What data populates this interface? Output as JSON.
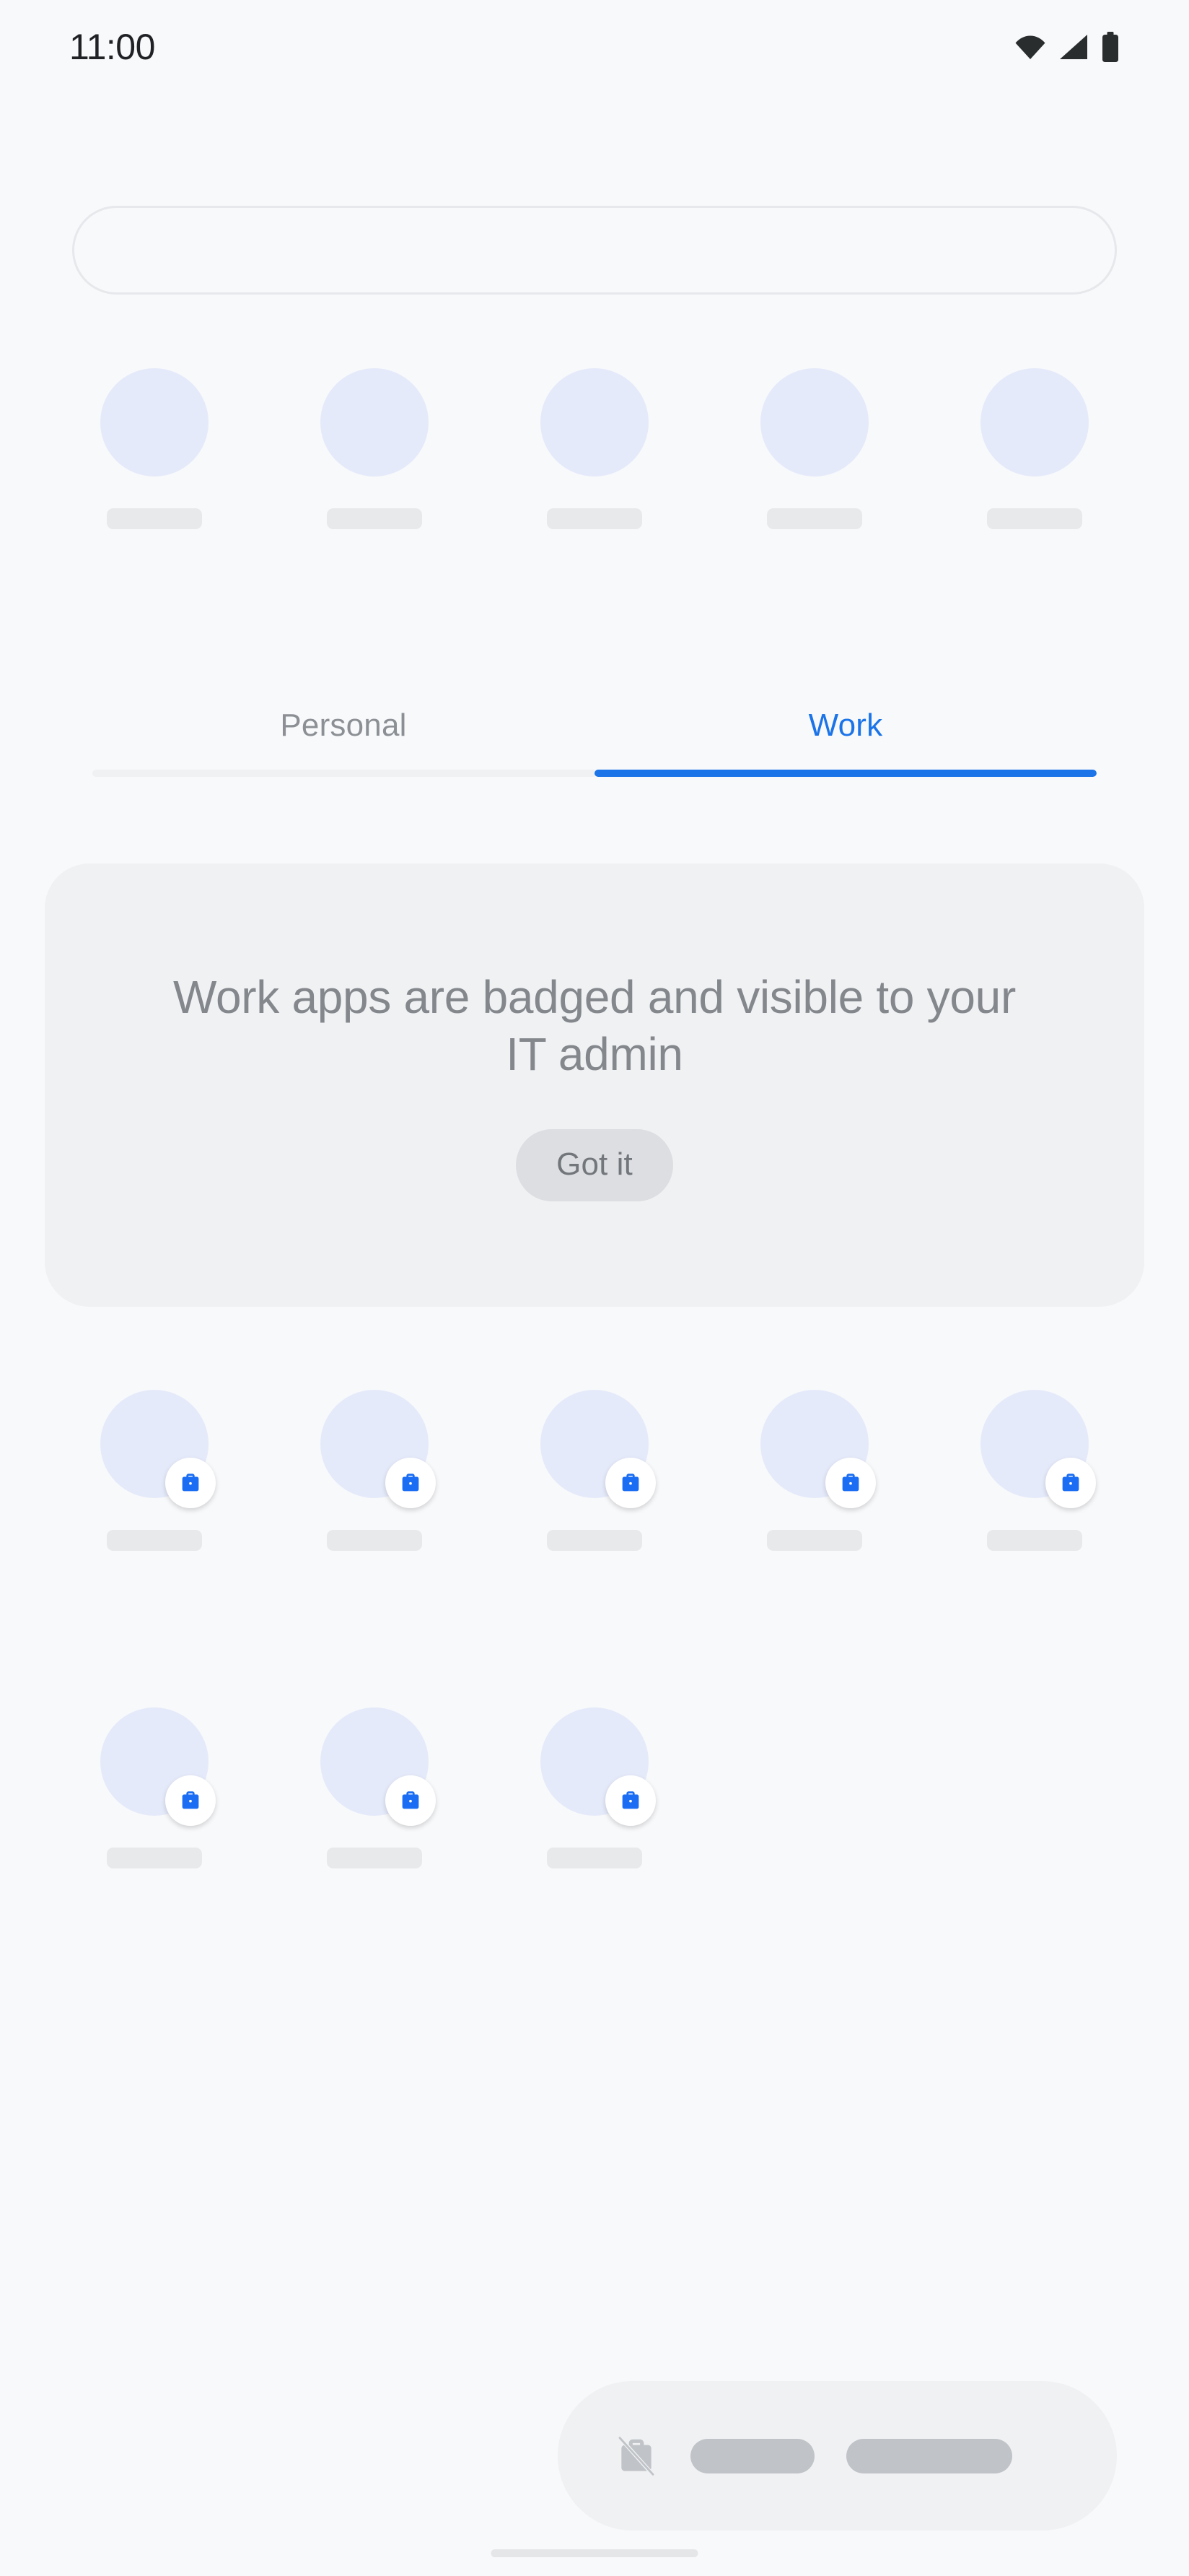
{
  "status_bar": {
    "time": "11:00",
    "icons": [
      {
        "name": "wifi-icon",
        "label": "Wi-Fi"
      },
      {
        "name": "cellular-signal-icon",
        "label": "Cellular signal"
      },
      {
        "name": "battery-icon",
        "label": "Battery"
      }
    ]
  },
  "search": {
    "value": "",
    "placeholder": ""
  },
  "top_apps": {
    "count": 5,
    "items": [
      {
        "label": "",
        "badged": false
      },
      {
        "label": "",
        "badged": false
      },
      {
        "label": "",
        "badged": false
      },
      {
        "label": "",
        "badged": false
      },
      {
        "label": "",
        "badged": false
      }
    ]
  },
  "tabs": {
    "items": [
      {
        "label": "Personal",
        "active": false
      },
      {
        "label": "Work",
        "active": true
      }
    ],
    "active_index": 1
  },
  "info_card": {
    "title": "Work apps are badged and visible to your IT admin",
    "button_label": "Got it"
  },
  "work_apps": {
    "row1": [
      {
        "label": "",
        "badged": true
      },
      {
        "label": "",
        "badged": true
      },
      {
        "label": "",
        "badged": true
      },
      {
        "label": "",
        "badged": true
      },
      {
        "label": "",
        "badged": true
      }
    ],
    "row2": [
      {
        "label": "",
        "badged": true
      },
      {
        "label": "",
        "badged": true
      },
      {
        "label": "",
        "badged": true
      }
    ]
  },
  "bottom_bar": {
    "icon": "work-off-icon",
    "pills": [
      {
        "size": "small"
      },
      {
        "size": "large"
      }
    ]
  },
  "colors": {
    "page_background": "#f8f9fb",
    "card_background": "#f0f1f3",
    "accent_blue": "#1b74e8",
    "badge_blue": "#1b6ef3",
    "app_icon_placeholder": "#e5eafa",
    "label_placeholder": "#e8e9eb",
    "muted_text": "#8c9095",
    "button_background": "#dcdee1",
    "button_text": "#73777c",
    "status_icon": "#2a2d2e"
  }
}
